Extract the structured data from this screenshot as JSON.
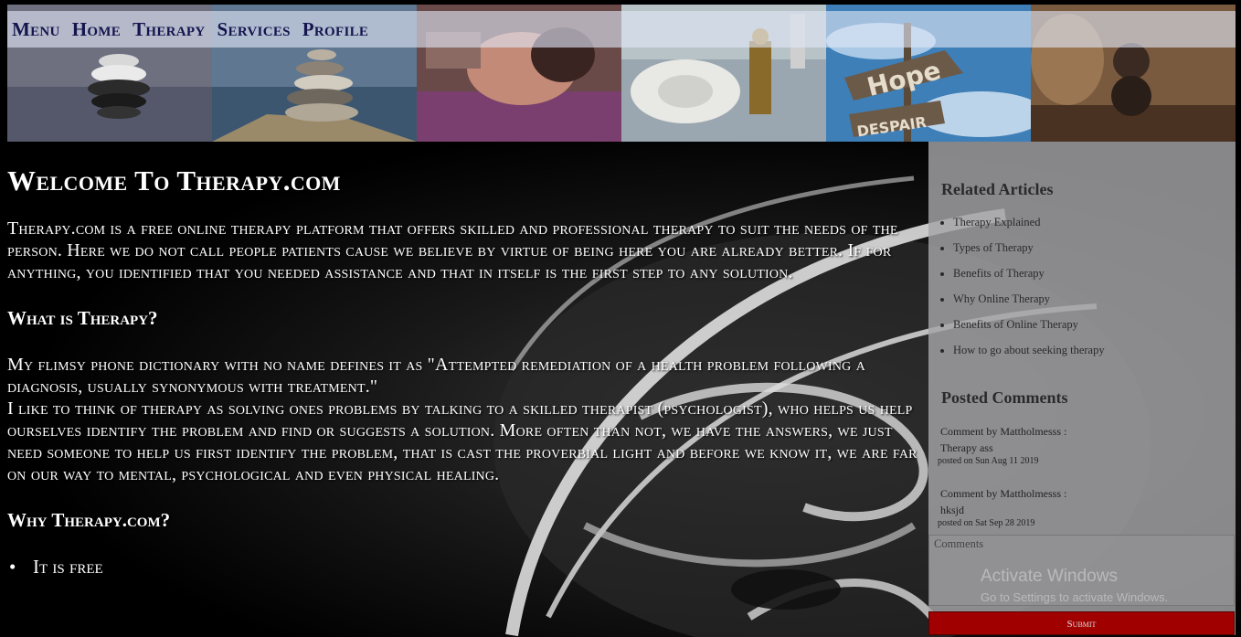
{
  "nav": {
    "items": [
      "Menu",
      "Home",
      "Therapy",
      "Services",
      "Profile"
    ]
  },
  "banner": {
    "tiles": [
      "stacked-stones-icon",
      "stone-cairn-icon",
      "relaxing-person-icon",
      "spa-towels-icon",
      "hope-despair-sign-icon",
      "balanced-stones-icon"
    ]
  },
  "main": {
    "title": "Welcome To Therapy.com",
    "intro": "Therapy.com is a free online therapy platform that offers skilled and professional therapy to suit the needs of the person. Here we do not call people patients cause we believe by virtue of being here you are already better. If for anything, you identified that you needed assistance and that in itself is the first step to any solution.",
    "what_heading": "What is Therapy?",
    "what_p1": "My flimsy phone dictionary with no name defines it as \"Attempted remediation of a health problem following a diagnosis, usually synonymous with treatment.\"",
    "what_p2": "I like to think of therapy as solving ones problems by talking to a skilled therapist (psychologist), who helps us help ourselves identify the problem and find or suggests a solution. More often than not, we have the answers, we just need someone to help us first identify the problem, that is cast the proverbial light and before we know it, we are far on our way to mental, psychological and even physical healing.",
    "why_heading": "Why Therapy.com?",
    "why_items": [
      "It is free"
    ]
  },
  "sidebar": {
    "related_title": "Related Articles",
    "related": [
      "Therapy Explained",
      "Types of Therapy",
      "Benefits of Therapy",
      "Why Online Therapy",
      "Benefits of Online Therapy",
      "How to go about seeking therapy"
    ],
    "comments_title": "Posted Comments",
    "comments": [
      {
        "by": "Comment by Mattholmesss :",
        "text": "Therapy ass",
        "date": "posted on Sun Aug 11 2019"
      },
      {
        "by": "Comment by Mattholmesss :",
        "text": "hksjd",
        "date": "posted on Sat Sep 28 2019"
      }
    ],
    "comment_placeholder": "Comments",
    "submit_label": "Submit"
  },
  "watermark": {
    "line1": "Activate Windows",
    "line2": "Go to Settings to activate Windows."
  }
}
